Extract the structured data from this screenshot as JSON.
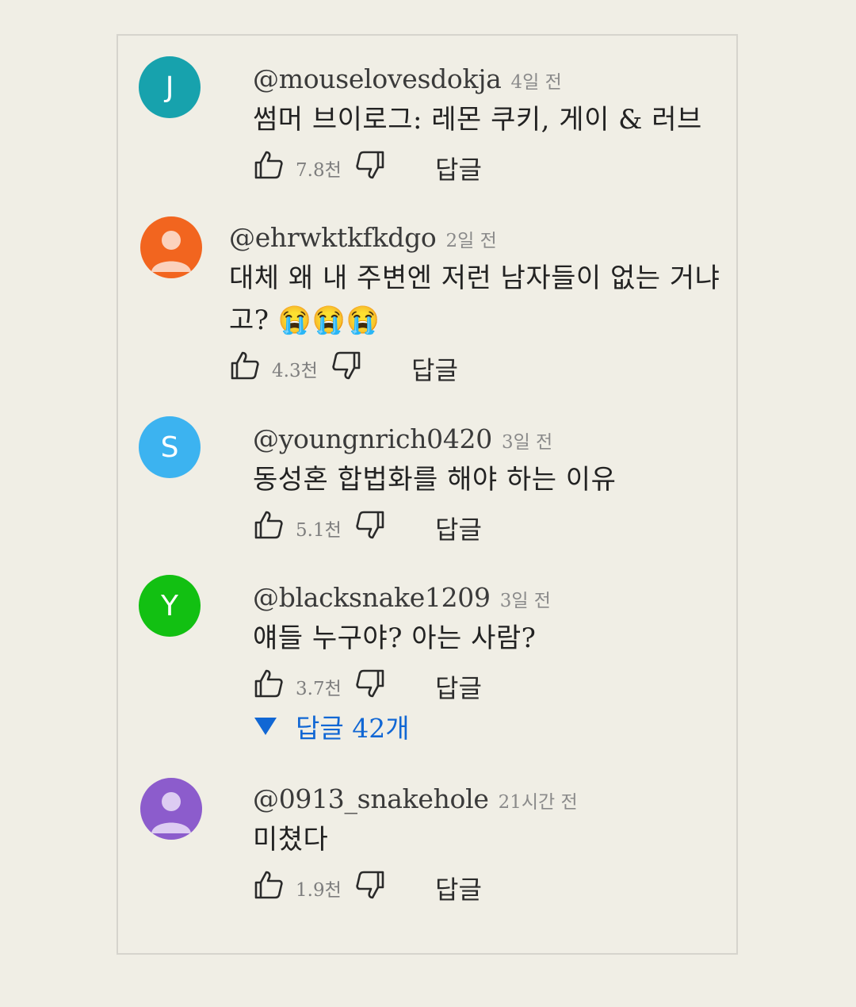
{
  "comments": [
    {
      "avatar": {
        "type": "letter",
        "letter": "J",
        "color": "#17a2ad"
      },
      "handle": "@mouselovesdokja",
      "time": "4일 전",
      "text": "썸머 브이로그: 레몬 쿠키, 게이 & 러브",
      "likes": "7.8천",
      "reply_label": "답글"
    },
    {
      "avatar": {
        "type": "default",
        "color": "#f2651f"
      },
      "handle": "@ehrwktkfkdgo",
      "time": "2일 전",
      "text": "대체 왜 내 주변엔 저런 남자들이 없는 거냐고? 😭😭😭",
      "likes": "4.3천",
      "reply_label": "답글"
    },
    {
      "avatar": {
        "type": "letter",
        "letter": "S",
        "color": "#3cb3f0"
      },
      "handle": "@youngnrich0420",
      "time": "3일 전",
      "text": "동성혼 합법화를 해야 하는 이유",
      "likes": "5.1천",
      "reply_label": "답글"
    },
    {
      "avatar": {
        "type": "letter",
        "letter": "Y",
        "color": "#12c012"
      },
      "handle": "@blacksnake1209",
      "time": "3일 전",
      "text": "얘들 누구야? 아는 사람?",
      "likes": "3.7천",
      "reply_label": "답글",
      "replies_toggle": "답글 42개"
    },
    {
      "avatar": {
        "type": "default",
        "color": "#8c5ccc"
      },
      "handle": "@0913_snakehole",
      "time": "21시간 전",
      "text": "미쳤다",
      "likes": "1.9천",
      "reply_label": "답글"
    }
  ],
  "icons": {
    "like": "thumbs-up-icon",
    "dislike": "thumbs-down-icon",
    "expand": "triangle-down-icon",
    "default_avatar": "person-icon"
  },
  "colors": {
    "background": "#f0eee5",
    "link": "#1167d4"
  }
}
